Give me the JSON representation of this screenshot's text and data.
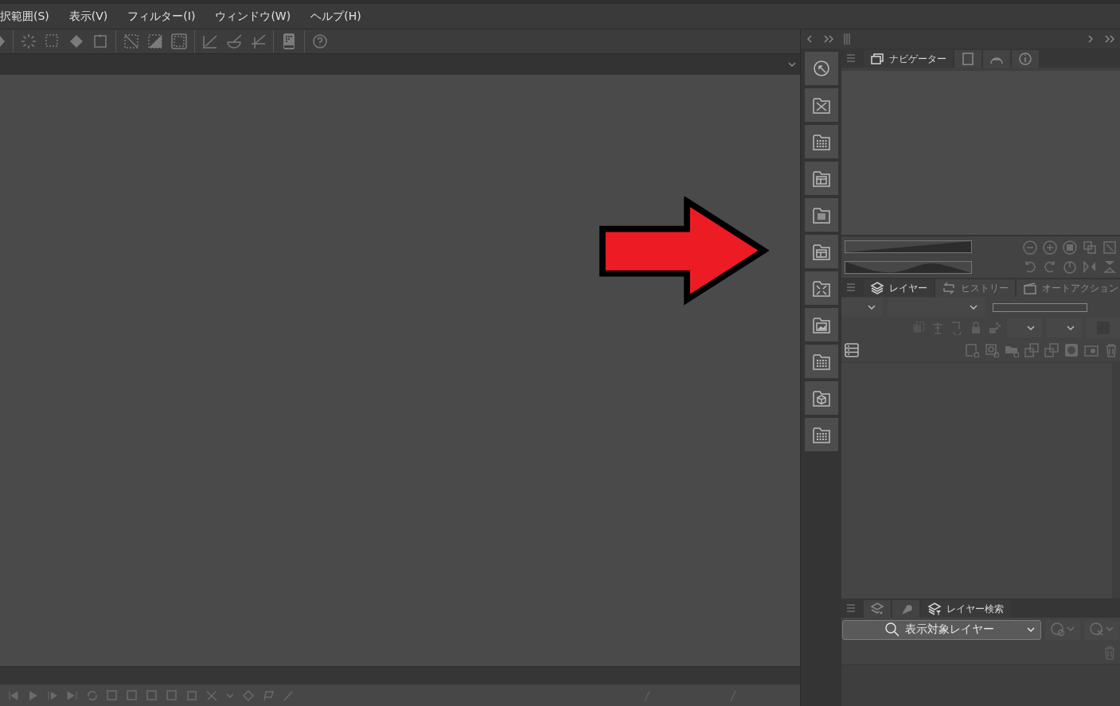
{
  "menu_bar": {
    "items": [
      "択範囲(S)",
      "表示(V)",
      "フィルター(I)",
      "ウィンドウ(W)",
      "ヘルプ(H)"
    ]
  },
  "navigator_panel": {
    "tabs": [
      {
        "kind": "text",
        "label": "ナビゲーター",
        "selected": true
      },
      {
        "kind": "icon",
        "selected": false
      },
      {
        "kind": "icon",
        "selected": false
      },
      {
        "kind": "icon",
        "selected": false
      }
    ]
  },
  "layer_panel": {
    "tabs": [
      {
        "kind": "text",
        "label": "レイヤー",
        "selected": true
      },
      {
        "kind": "text",
        "label": "ヒストリー",
        "selected": false
      },
      {
        "kind": "text",
        "label": "オートアクション",
        "selected": false
      }
    ]
  },
  "layer_search_panel": {
    "tabs": [
      {
        "kind": "icon",
        "selected": false
      },
      {
        "kind": "icon",
        "selected": false
      },
      {
        "kind": "text",
        "label": "レイヤー検索",
        "selected": true
      }
    ],
    "search_target": {
      "value": "表示対象レイヤー"
    }
  },
  "layer_properties": {
    "opacity": {
      "level": 0
    }
  }
}
